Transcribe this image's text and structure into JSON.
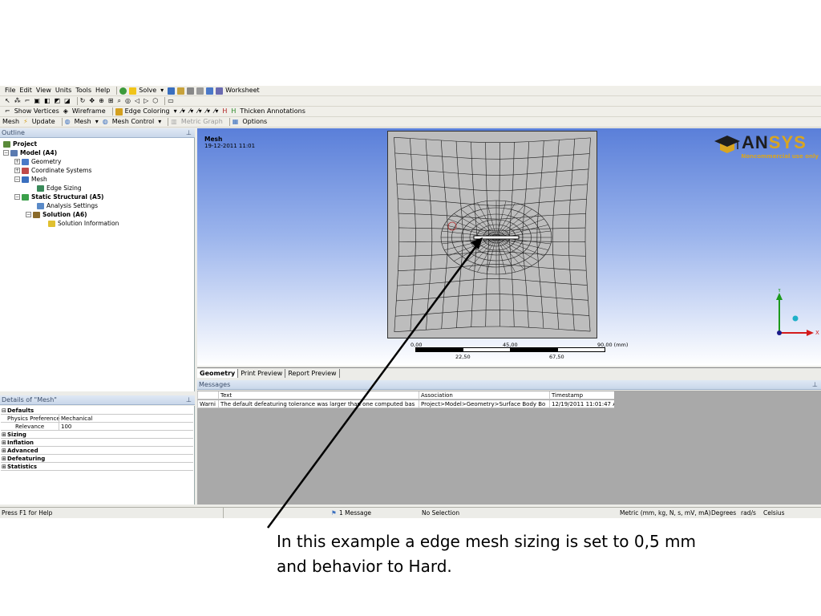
{
  "menu": [
    "File",
    "Edit",
    "View",
    "Units",
    "Tools",
    "Help"
  ],
  "toolbar1": {
    "solve": "Solve",
    "worksheet": "Worksheet"
  },
  "toolbar3": {
    "show_vertices": "Show Vertices",
    "wireframe": "Wireframe",
    "edge_coloring": "Edge Coloring",
    "thicken": "Thicken Annotations"
  },
  "toolbar4": {
    "mesh_label": "Mesh",
    "update": "Update",
    "mesh": "Mesh",
    "mesh_control": "Mesh Control",
    "metric_graph": "Metric Graph",
    "options": "Options"
  },
  "outline": {
    "title": "Outline",
    "items": [
      {
        "label": "Project"
      },
      {
        "label": "Model (A4)"
      },
      {
        "label": "Geometry"
      },
      {
        "label": "Coordinate Systems"
      },
      {
        "label": "Mesh"
      },
      {
        "label": "Edge Sizing"
      },
      {
        "label": "Static Structural (A5)"
      },
      {
        "label": "Analysis Settings"
      },
      {
        "label": "Solution (A6)"
      },
      {
        "label": "Solution Information"
      }
    ]
  },
  "details": {
    "title": "Details of \"Mesh\"",
    "rows": [
      {
        "label": "Defaults",
        "value": ""
      },
      {
        "label": "Physics Preference",
        "value": "Mechanical"
      },
      {
        "label": "Relevance",
        "value": "100"
      },
      {
        "label": "Sizing",
        "value": ""
      },
      {
        "label": "Inflation",
        "value": ""
      },
      {
        "label": "Advanced",
        "value": ""
      },
      {
        "label": "Defeaturing",
        "value": ""
      },
      {
        "label": "Statistics",
        "value": ""
      }
    ]
  },
  "viewport": {
    "title": "Mesh",
    "date": "19-12-2011 11:01",
    "logo_sub": "Noncommercial use only",
    "scale": {
      "labels_top": [
        "0,00",
        "45,00",
        "90,00 (mm)"
      ],
      "labels_bottom": [
        "22,50",
        "67,50"
      ]
    },
    "axis_y": "Y",
    "axis_x": "X",
    "mesh_count": {
      "cols": 13,
      "rows": 13
    }
  },
  "tabs": [
    "Geometry",
    "Print Preview",
    "Report Preview"
  ],
  "messages": {
    "title": "Messages",
    "headers": [
      "Text",
      "Association",
      "Timestamp"
    ],
    "row": {
      "type": "Warni",
      "text": "The default defeaturing tolerance was larger than one computed bas",
      "association": "Project>Model>Geometry>Surface Body Bo",
      "timestamp": "12/19/2011 11:01:47 A"
    }
  },
  "status": {
    "help": "Press F1 for Help",
    "messages": "1 Message",
    "selection": "No Selection",
    "units": "Metric (mm, kg, N, s, mV, mA)",
    "degrees": "Degrees",
    "rads": "rad/s",
    "temp": "Celsius"
  },
  "caption": {
    "line1": "In this example a edge mesh sizing is set to 0,5 mm",
    "line2": "and behavior to Hard."
  }
}
